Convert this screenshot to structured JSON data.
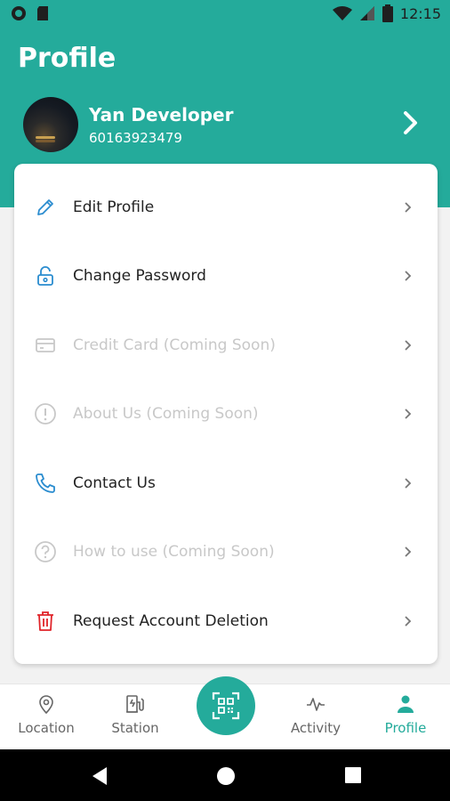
{
  "status_bar": {
    "time": "12:15",
    "left_icons": [
      "circle-notification-icon",
      "sd-card-icon"
    ],
    "right_icons": [
      "wifi-icon",
      "signal-icon",
      "battery-icon"
    ]
  },
  "header": {
    "title": "Profile",
    "user_name": "Yan Developer",
    "user_phone": "60163923479"
  },
  "menu": {
    "items": [
      {
        "label": "Edit Profile",
        "icon": "pencil-icon",
        "enabled": true
      },
      {
        "label": "Change Password",
        "icon": "lock-icon",
        "enabled": true
      },
      {
        "label": "Credit Card (Coming Soon)",
        "icon": "credit-card-icon",
        "enabled": false
      },
      {
        "label": "About Us (Coming Soon)",
        "icon": "info-icon",
        "enabled": false
      },
      {
        "label": "Contact Us",
        "icon": "phone-icon",
        "enabled": true
      },
      {
        "label": "How to use (Coming Soon)",
        "icon": "help-icon",
        "enabled": false
      },
      {
        "label": "Request Account Deletion",
        "icon": "trash-icon",
        "enabled": true
      }
    ]
  },
  "tabs": {
    "items": [
      {
        "label": "Location",
        "icon": "map-pin-icon",
        "active": false
      },
      {
        "label": "Station",
        "icon": "charging-station-icon",
        "active": false
      },
      {
        "label": "Activity",
        "icon": "activity-icon",
        "active": false
      },
      {
        "label": "Profile",
        "icon": "person-icon",
        "active": true
      }
    ],
    "center_button_icon": "qr-scan-icon"
  },
  "colors": {
    "accent": "#24ab9b",
    "icon_blue": "#2a8ccf",
    "delete_red": "#e0242a",
    "disabled": "#c8c8c8"
  }
}
